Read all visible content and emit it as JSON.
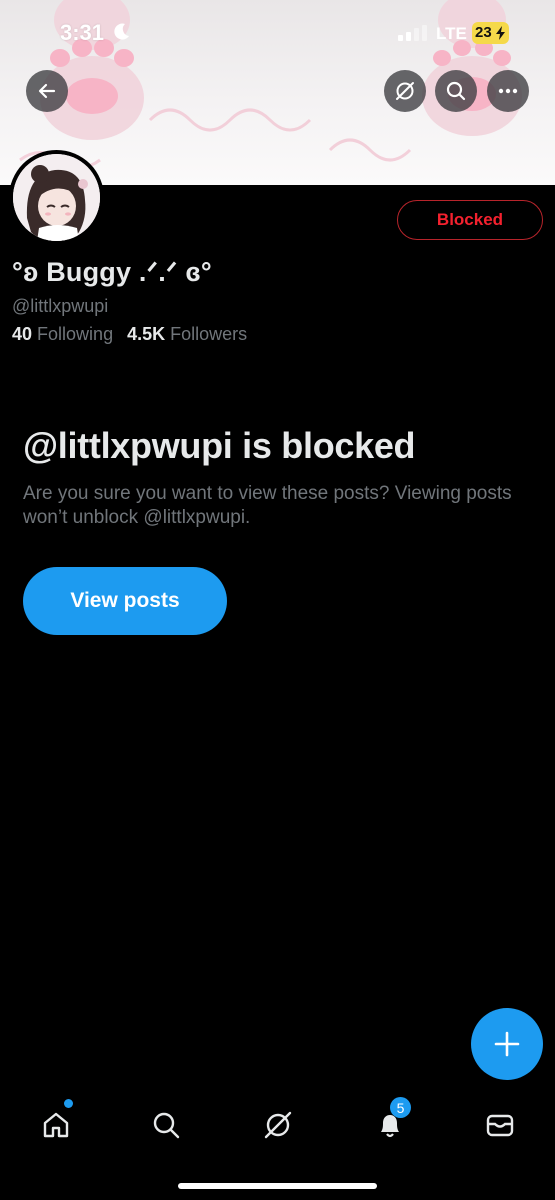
{
  "status_bar": {
    "time": "3:31",
    "network": "LTE",
    "battery": "23"
  },
  "profile": {
    "display_name": "°ʚ Buggy .ᐟ.ᐟ ɞ°",
    "handle": "@littlxpwupi",
    "following_count": "40",
    "following_label": "Following",
    "followers_count": "4.5K",
    "followers_label": "Followers",
    "blocked_button": "Blocked"
  },
  "blocked_notice": {
    "title": "@littlxpwupi is blocked",
    "description": "Are you sure you want to view these posts? Viewing posts won’t unblock @littlxpwupi.",
    "view_posts_button": "View posts"
  },
  "tabbar": {
    "notifications_badge": "5"
  },
  "icons": {
    "back": "back-arrow-icon",
    "grok": "grok-icon",
    "search": "search-icon",
    "more": "more-icon",
    "compose": "plus-icon",
    "home": "home-icon",
    "explore": "search-icon",
    "grok_tab": "grok-icon",
    "notifications": "bell-icon",
    "messages": "mail-icon"
  },
  "colors": {
    "accent": "#1d9bf0",
    "blocked_red": "#f4212e",
    "background": "#000000",
    "secondary_text": "#71767b"
  }
}
